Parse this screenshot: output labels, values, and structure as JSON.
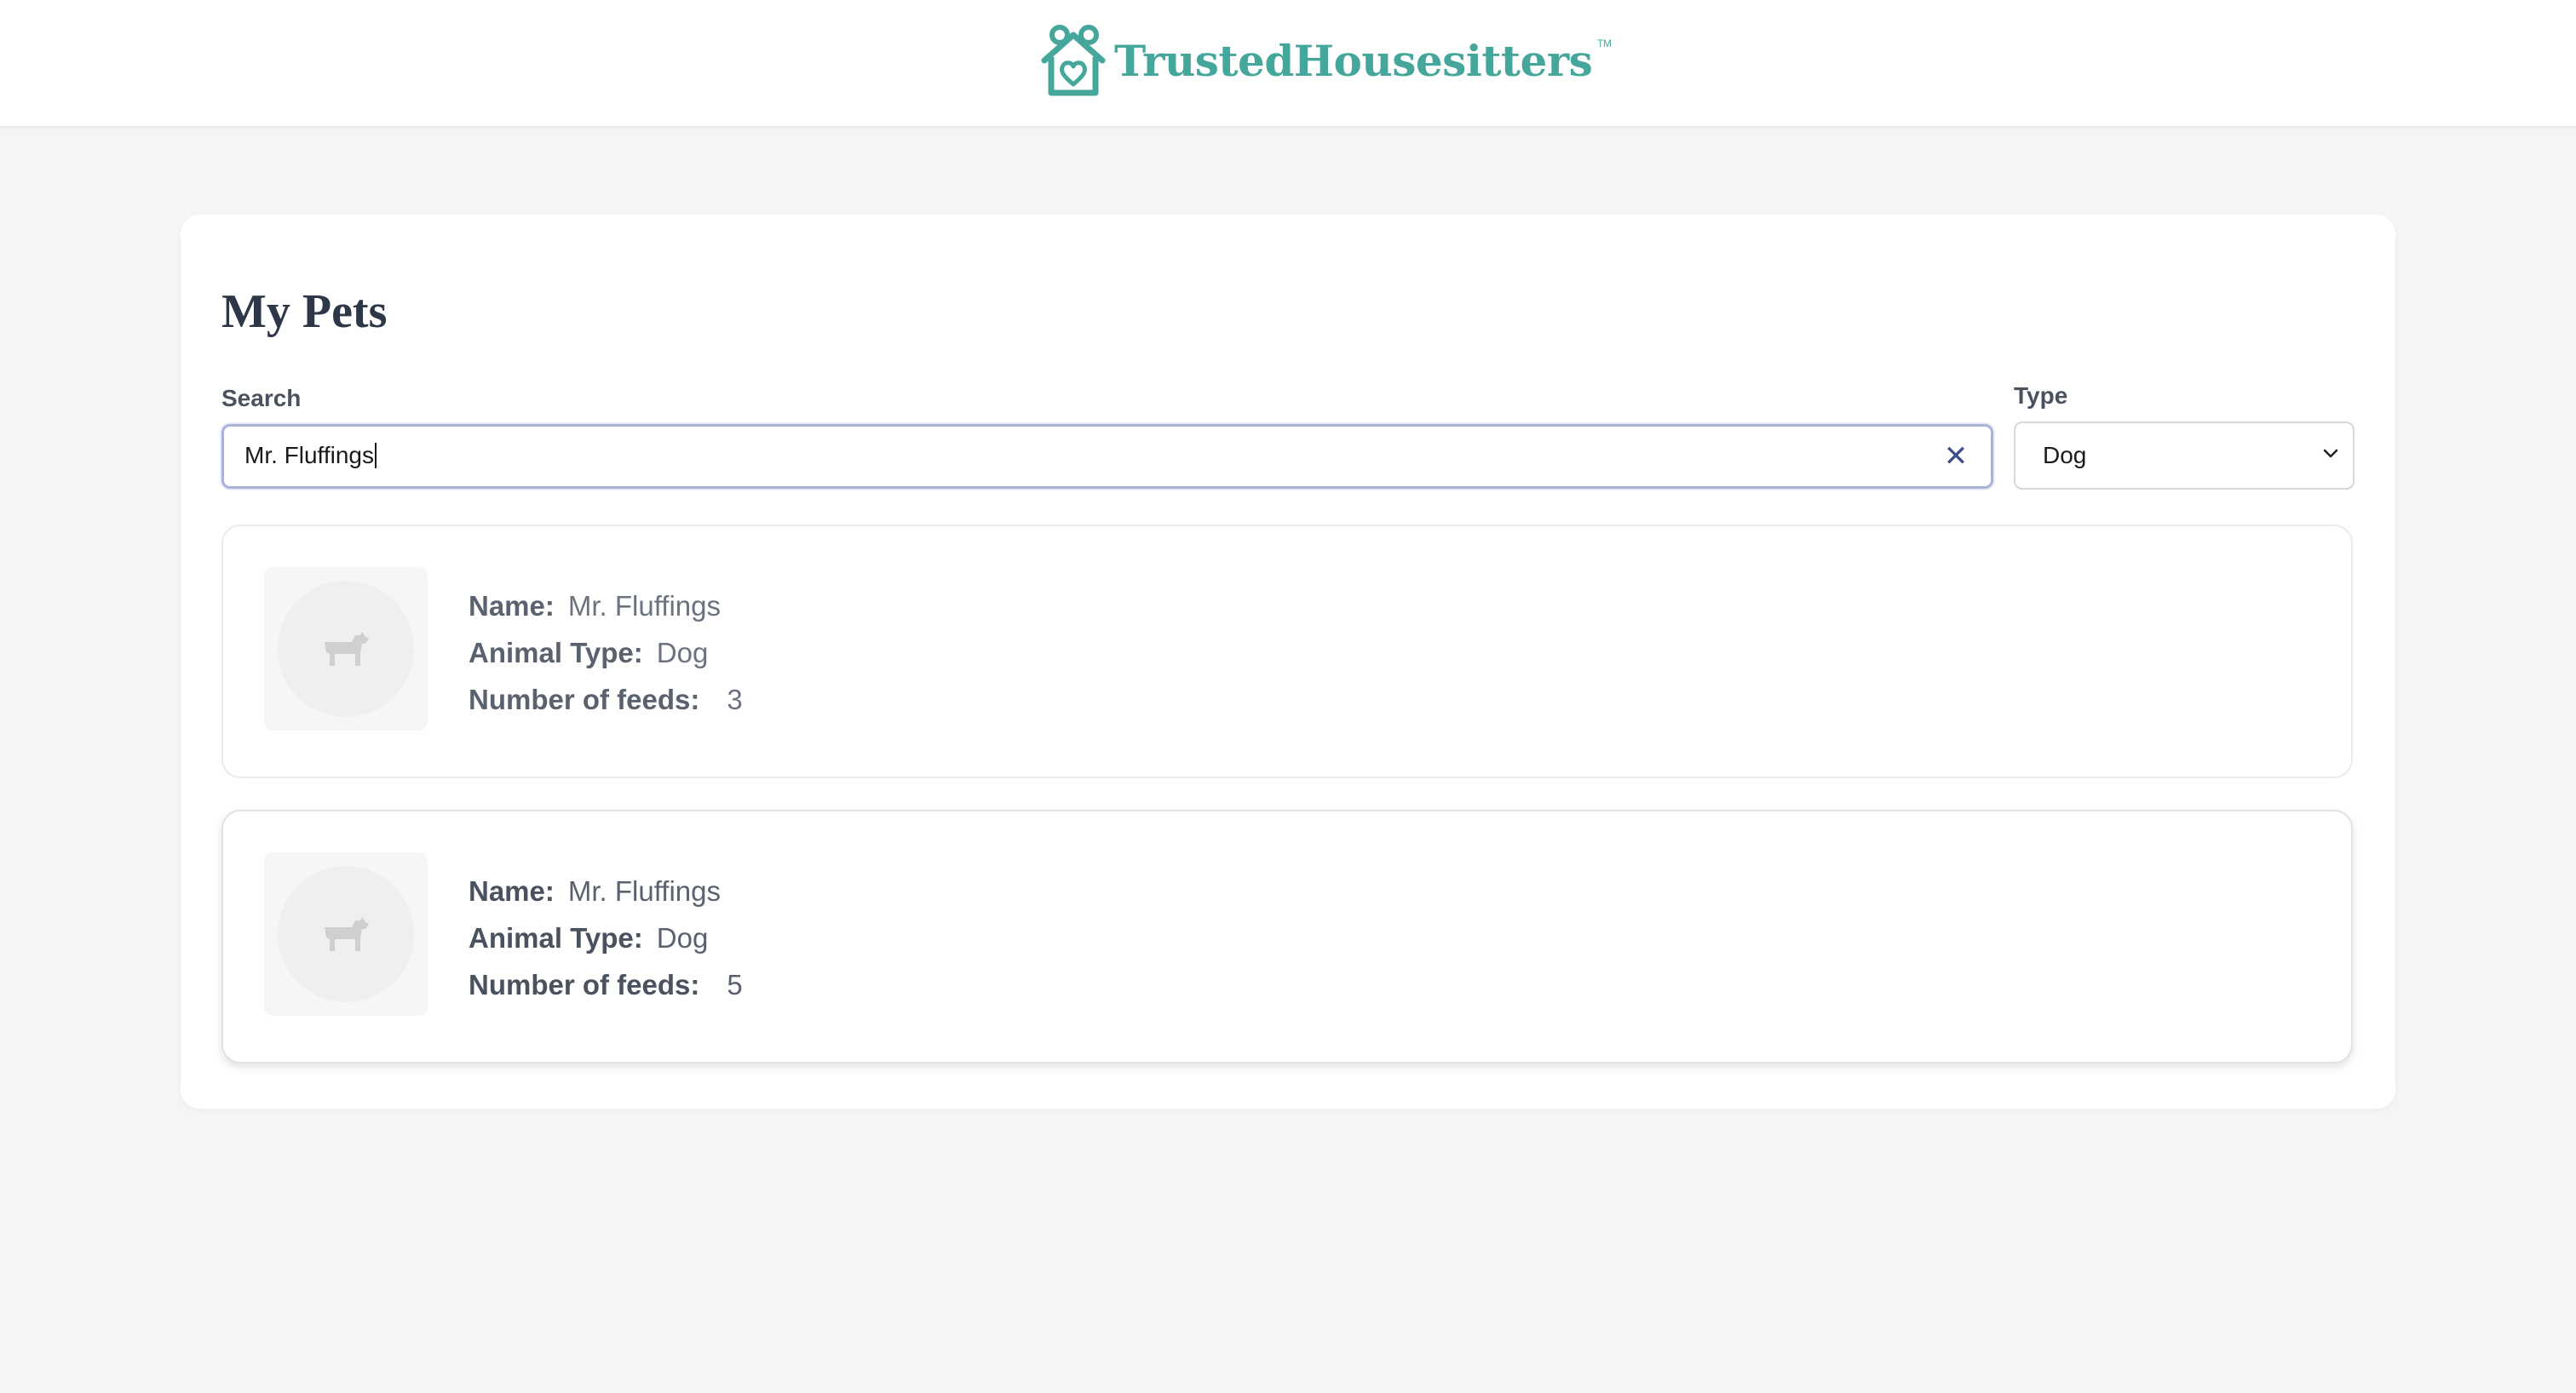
{
  "header": {
    "logo_text": "TrustedHousesitters",
    "logo_tm": "TM",
    "logo_color": "#45a79b"
  },
  "page": {
    "title": "My Pets"
  },
  "filters": {
    "search_label": "Search",
    "search_value": "Mr. Fluffings",
    "clear_icon": "close-icon",
    "type_label": "Type",
    "type_value": "Dog",
    "type_options": [
      "Dog"
    ]
  },
  "labels": {
    "name": "Name:",
    "animal_type": "Animal Type:",
    "feeds": "Number of feeds:"
  },
  "pets": [
    {
      "name": "Mr. Fluffings",
      "animal_type": "Dog",
      "feeds": "3",
      "icon": "dog-icon"
    },
    {
      "name": "Mr. Fluffings",
      "animal_type": "Dog",
      "feeds": "5",
      "icon": "dog-icon"
    }
  ]
}
